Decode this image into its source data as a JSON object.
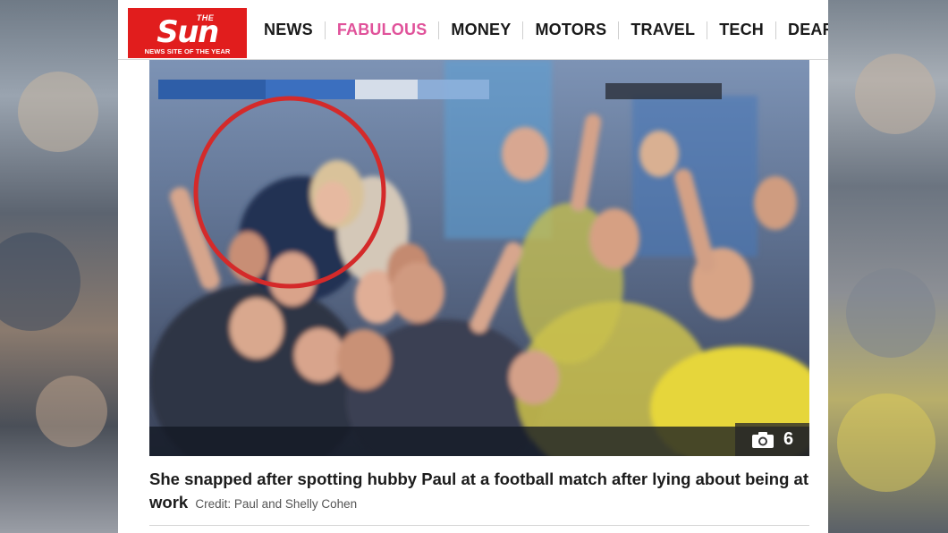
{
  "logo": {
    "the": "THE",
    "word": "Sun",
    "tagline": "NEWS SITE OF THE YEAR"
  },
  "nav": {
    "items": [
      {
        "label": "NEWS",
        "color": "#1a1a1a"
      },
      {
        "label": "FABULOUS",
        "color": "#e0529a"
      },
      {
        "label": "MONEY",
        "color": "#1a1a1a"
      },
      {
        "label": "MOTORS",
        "color": "#1a1a1a"
      },
      {
        "label": "TRAVEL",
        "color": "#1a1a1a"
      },
      {
        "label": "TECH",
        "color": "#1a1a1a"
      },
      {
        "label": "DEAR DEIDRE",
        "color": "#1a1a1a"
      }
    ]
  },
  "photo": {
    "gallery_icon": "camera-icon",
    "gallery_count": "6"
  },
  "caption": {
    "text": "She snapped after spotting hubby Paul at a football match after lying about being at work",
    "credit": "Credit: Paul and Shelly Cohen"
  },
  "colors": {
    "brand_red": "#e11d1d",
    "highlight_circle": "#d42a2a"
  }
}
